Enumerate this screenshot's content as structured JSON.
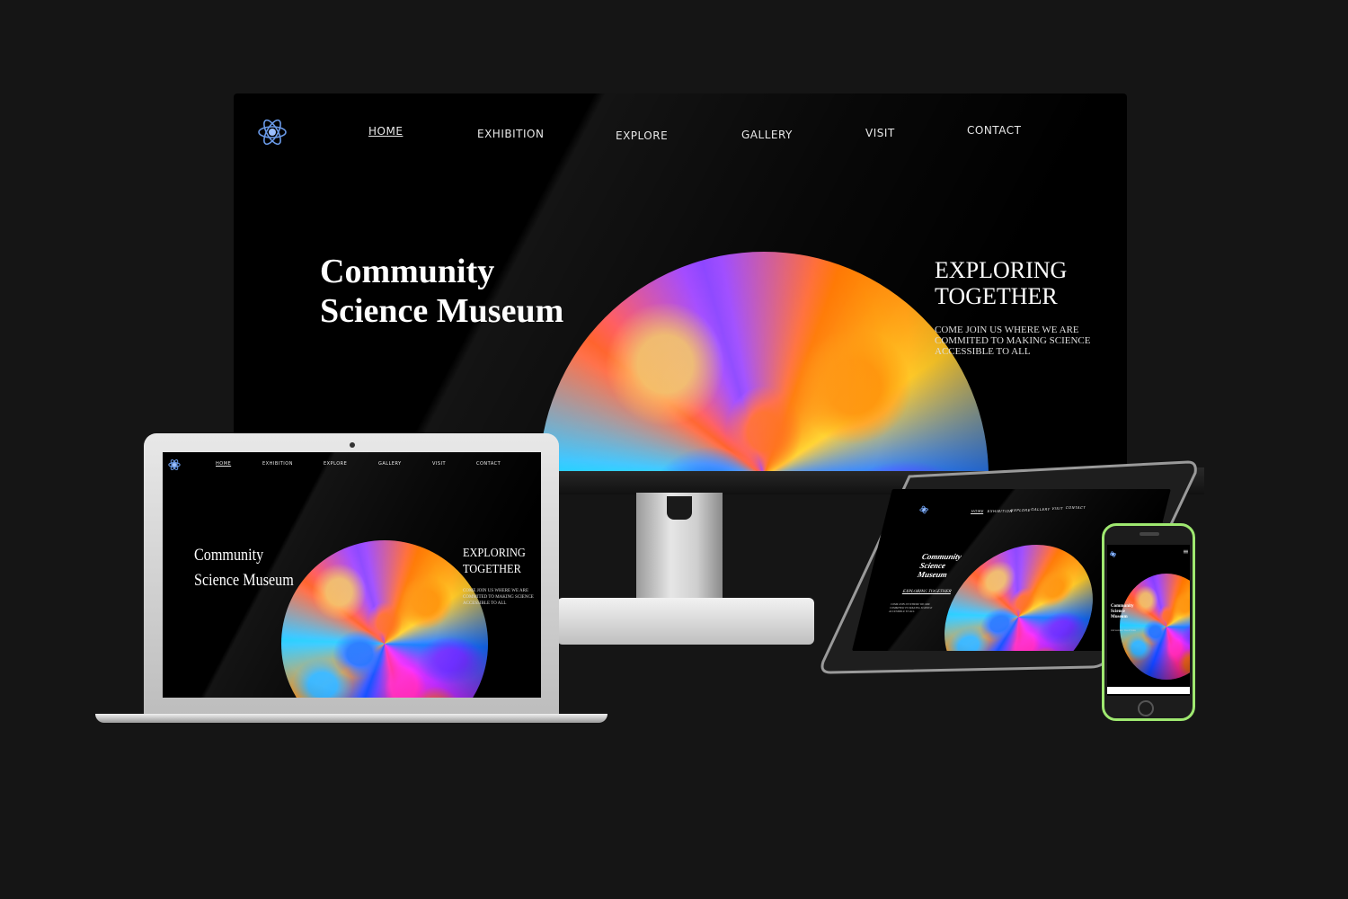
{
  "site": {
    "nav": [
      "HOME",
      "EXHIBITION",
      "EXPLORE",
      "GALLERY",
      "VISIT",
      "CONTACT"
    ],
    "title_line1": "Community",
    "title_line2": "Science Museum",
    "phone_title_line1": "Community",
    "phone_title_line2": "Science",
    "phone_title_line3": "Museum",
    "tagline_line1": "EXPLORING",
    "tagline_line2": "TOGETHER",
    "tagline_full": "EXPLORING TOGETHER",
    "body_line1": "COME JOIN US WHERE WE ARE",
    "body_line2": "COMMITED TO MAKING SCIENCE",
    "body_line3": "ACCESSIBLE TO ALL",
    "menu_icon": "≡"
  },
  "icons": {
    "logo": "atom-logo-icon",
    "menu": "hamburger-menu-icon"
  },
  "colors": {
    "background": "#151515",
    "screen": "#000000",
    "phone_frame": "#9fe870",
    "logo": "#6a9ae8"
  }
}
